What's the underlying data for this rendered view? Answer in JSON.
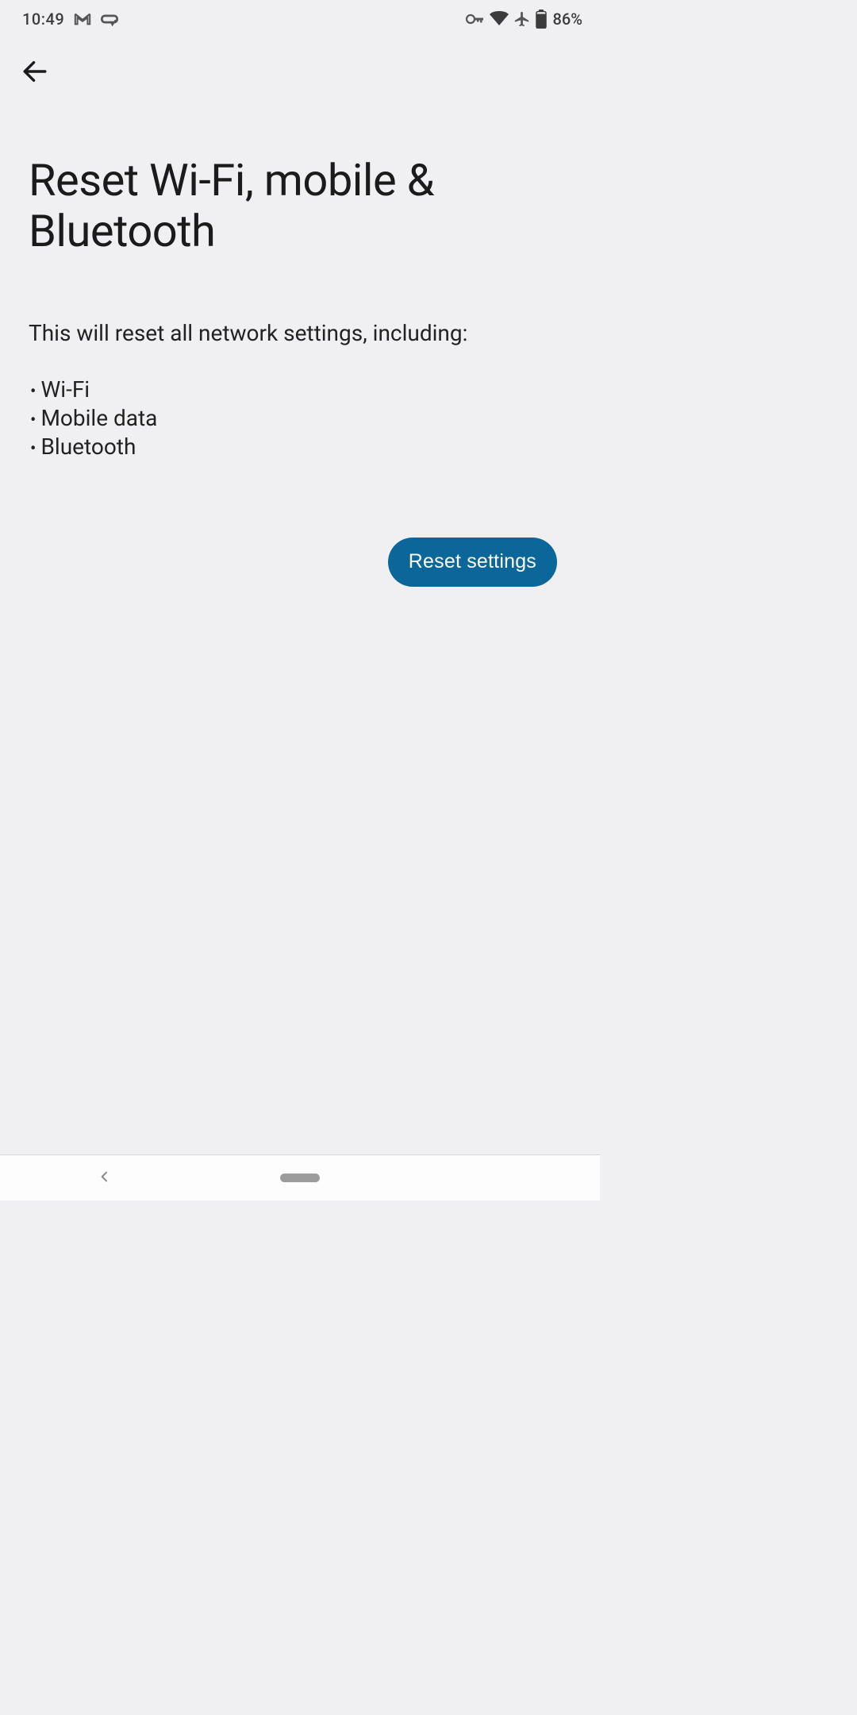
{
  "status_bar": {
    "time": "10:49",
    "battery_text": "86%"
  },
  "page": {
    "title": "Reset Wi-Fi, mobile & Bluetooth",
    "description": "This will reset all network settings, including:",
    "bullets": {
      "0": "Wi-Fi",
      "1": "Mobile data",
      "2": "Bluetooth"
    },
    "reset_button_label": "Reset settings"
  },
  "colors": {
    "accent": "#0b6699",
    "background": "#f0f0f3"
  }
}
